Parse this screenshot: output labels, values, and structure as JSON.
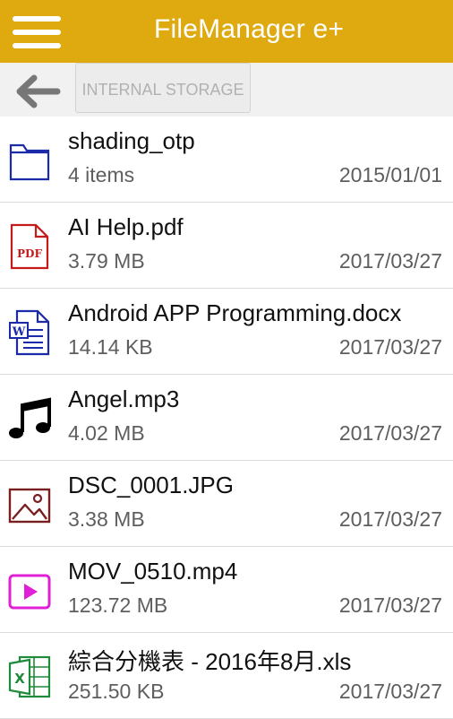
{
  "app": {
    "title": "FileManager e+"
  },
  "colors": {
    "toolbar": "#deaa10",
    "path_bar": "#f1f1f1",
    "divider": "#dcdcdc"
  },
  "path": {
    "crumb": "INTERNAL STORAGE"
  },
  "files": [
    {
      "icon": "folder-icon",
      "name": "shading_otp",
      "info": "4 items",
      "date": "2015/01/01"
    },
    {
      "icon": "pdf-file-icon",
      "name": "AI Help.pdf",
      "info": "3.79 MB",
      "date": "2017/03/27",
      "icon_label": "PDF"
    },
    {
      "icon": "word-document-icon",
      "name": "Android APP Programming.docx",
      "info": "14.14 KB",
      "date": "2017/03/27",
      "icon_label": "W"
    },
    {
      "icon": "music-note-icon",
      "name": "Angel.mp3",
      "info": "4.02 MB",
      "date": "2017/03/27"
    },
    {
      "icon": "image-file-icon",
      "name": "DSC_0001.JPG",
      "info": "3.38 MB",
      "date": "2017/03/27"
    },
    {
      "icon": "video-file-icon",
      "name": "MOV_0510.mp4",
      "info": "123.72 MB",
      "date": "2017/03/27"
    },
    {
      "icon": "excel-spreadsheet-icon",
      "name": "綜合分機表 -  2016年8月.xls",
      "info": "251.50 KB",
      "date": "2017/03/27",
      "icon_label": "X"
    }
  ]
}
